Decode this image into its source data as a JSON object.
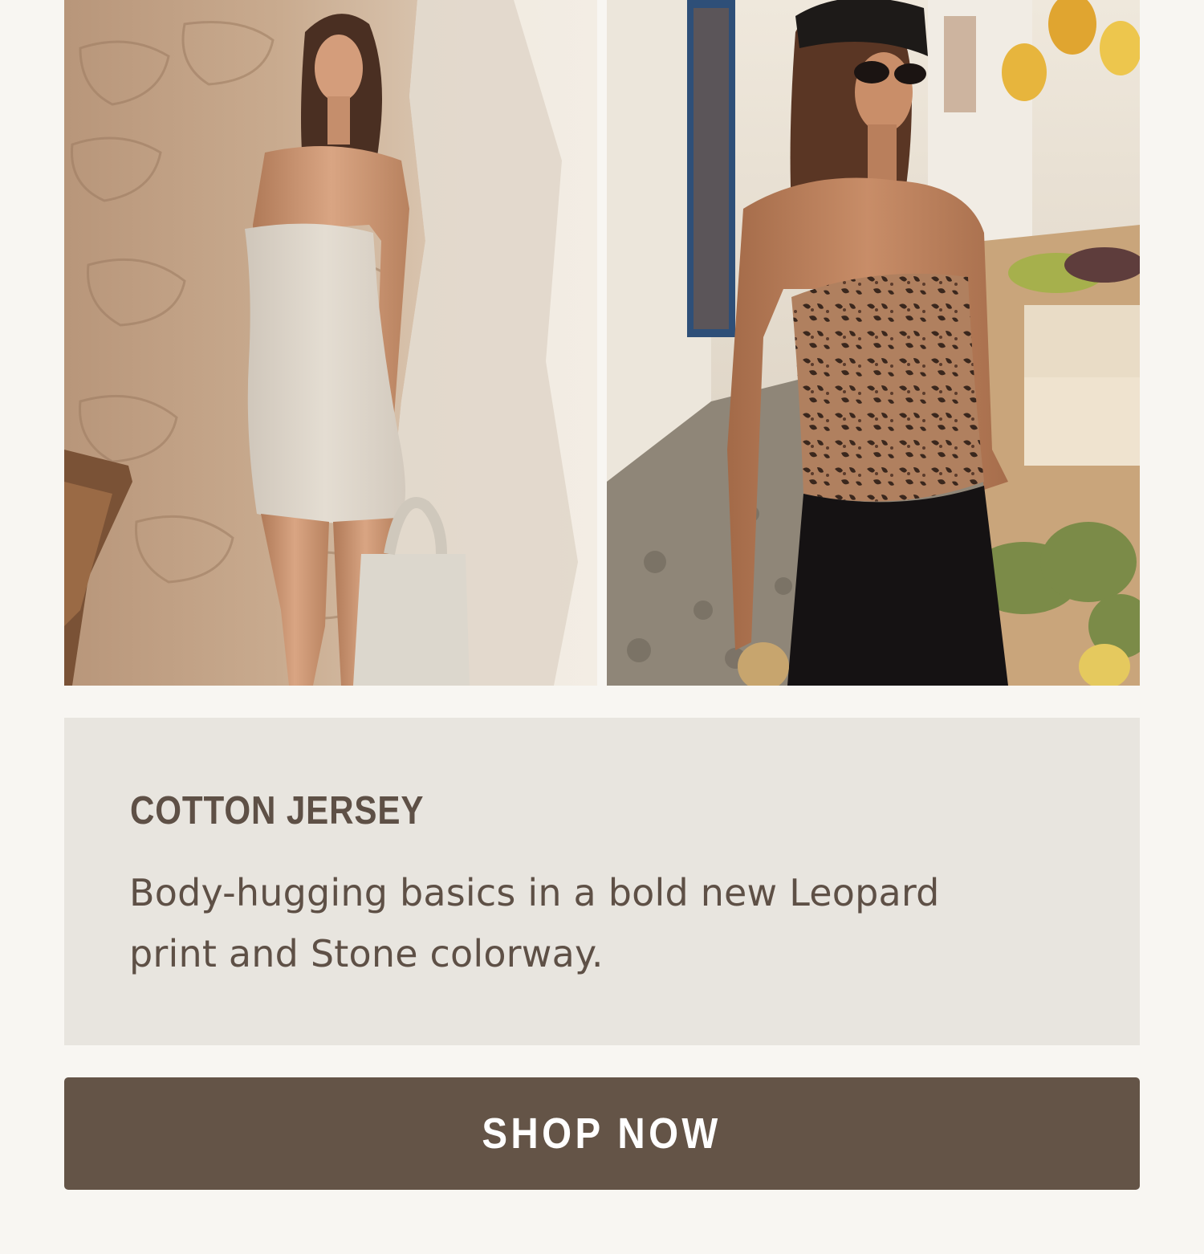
{
  "photos": {
    "left": {
      "alt": "Model in Stone strapless cotton jersey mini dress leaning on a stone wall"
    },
    "right": {
      "alt": "Model in Leopard print strapless cotton jersey top at an outdoor market"
    }
  },
  "promo": {
    "title": "COTTON JERSEY",
    "body": "Body-hugging basics in a bold new Leopard print and Stone colorway."
  },
  "cta": {
    "label": "SHOP NOW"
  },
  "colors": {
    "page_bg": "#f8f6f2",
    "card_bg": "#e8e5df",
    "text": "#5e5046",
    "button": "#645447"
  }
}
